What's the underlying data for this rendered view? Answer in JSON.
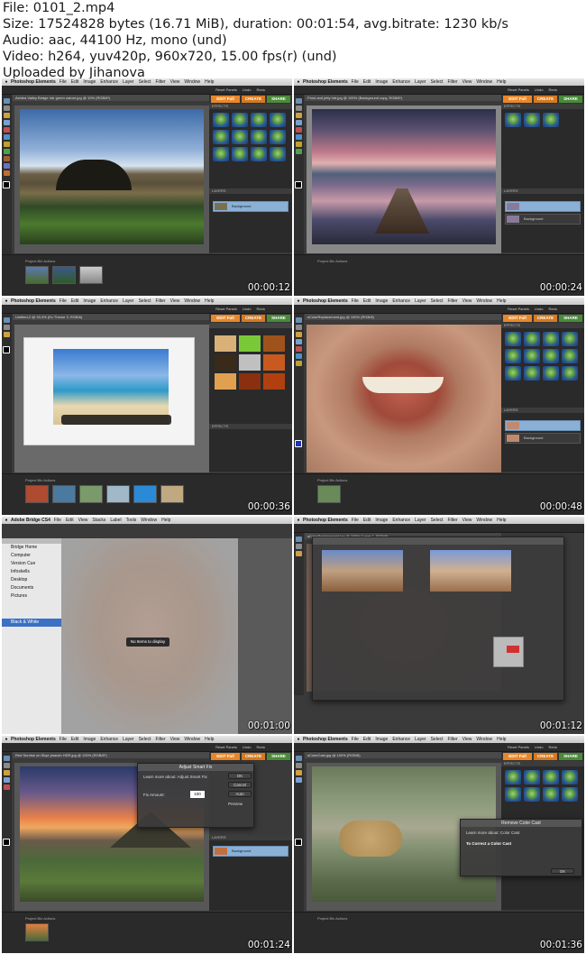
{
  "file_info": {
    "line_file": "File: 0101_2.mp4",
    "line_size": "Size: 17524828 bytes (16.71 MiB), duration: 00:01:54, avg.bitrate: 1230 kb/s",
    "line_audio": "Audio: aac, 44100 Hz, mono (und)",
    "line_video": "Video: h264, yuv420p, 960x720, 15.00 fps(r) (und)",
    "line_upload": "Uploaded by Jihanova"
  },
  "app": {
    "name": "Photoshop Elements",
    "menu": [
      "File",
      "Edit",
      "Image",
      "Enhance",
      "Layer",
      "Select",
      "Filter",
      "View",
      "Window",
      "Help"
    ],
    "modes": {
      "edit": "EDIT Full",
      "create": "CREATE",
      "share": "SHARE"
    },
    "panels_labels": [
      "Reset Panels",
      "Undo",
      "Redo"
    ],
    "effects_label": "EFFECTS",
    "layers_label": "LAYERS",
    "layer_name": "Background",
    "project_bin": "PROJECT BIN",
    "project_bin_sub": "Project Bin Actions"
  },
  "bridge": {
    "name": "Adobe Bridge CS4",
    "menu": [
      "File",
      "Edit",
      "View",
      "Stacks",
      "Label",
      "Tools",
      "Window",
      "Help"
    ],
    "favorites": [
      "Bridge Home",
      "Computer",
      "Version Cue",
      "Infoskells",
      "Desktop",
      "Documents",
      "Pictures"
    ],
    "collection": "Black & White",
    "no_items": "No Items to display"
  },
  "frames": [
    {
      "timestamp": "00:00:12",
      "tab": "Ashlea Valley Bridge hdr green nature.jpg @ 10% (RGB/8*)",
      "scene": "bridge"
    },
    {
      "timestamp": "00:00:24",
      "tab": "Pond and jetty hdr.jpg @ 100% (Background copy, RGB/8*)",
      "scene": "lake"
    },
    {
      "timestamp": "00:00:36",
      "tab": "Untitled-2 @ 33.3% (Ex Theme 3, RGB/8)",
      "scene": "beach"
    },
    {
      "timestamp": "00:00:48",
      "tab": "sColorReplacement.jpg @ 100% (RGB/8)",
      "scene": "lips"
    },
    {
      "timestamp": "00:01:00",
      "tab": "",
      "scene": "bridge-app"
    },
    {
      "timestamp": "00:01:12",
      "tab": "sColorReplacement.jpg @ 100% (Layer 1, RGB/8)",
      "scene": "curves"
    },
    {
      "timestamp": "00:01:24",
      "tab": "Red Sunrise on Skye jmacdo HDR.jpg @ 100% (RGB/8*)",
      "scene": "sunset"
    },
    {
      "timestamp": "00:01:36",
      "tab": "sColorCast.jpg @ 100% (RGB/8)",
      "scene": "leopard"
    }
  ],
  "dialogs": {
    "black_white": "Black & White",
    "smart_fix": {
      "title": "Adjust Smart Fix",
      "learn": "Learn more about: Adjust Smart Fix",
      "label": "Fix Amount:",
      "value": "100",
      "ok": "OK",
      "cancel": "Cancel",
      "auto": "Auto",
      "preview": "Preview"
    },
    "color_cast": {
      "title": "Remove Color Cast",
      "learn": "Learn more about: Color Cast",
      "heading": "To Correct a Color Cast",
      "ok": "OK",
      "cancel": "Cancel"
    }
  }
}
